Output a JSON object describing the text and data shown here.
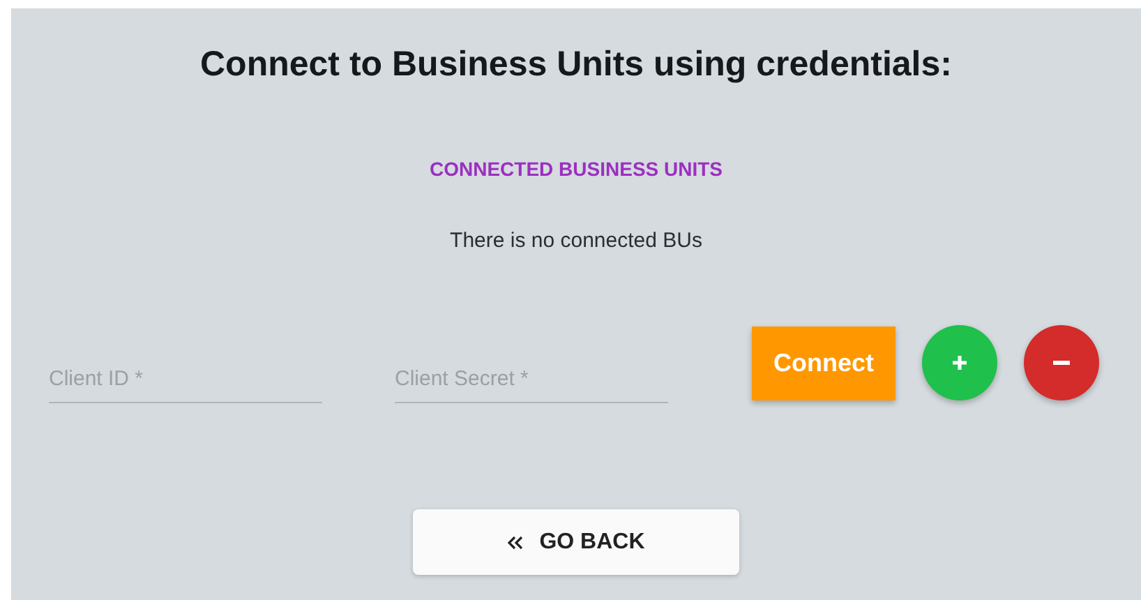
{
  "title": "Connect to Business Units using credentials:",
  "connected_section": {
    "heading": "CONNECTED BUSINESS UNITS",
    "empty_message": "There is no connected BUs"
  },
  "fields": [
    {
      "placeholder": "Client ID *"
    },
    {
      "placeholder": "Client Secret *"
    }
  ],
  "buttons": [
    {
      "kind": "text",
      "label": "Connect"
    },
    {
      "kind": "add"
    },
    {
      "kind": "remove"
    }
  ],
  "back_button": {
    "label": "GO BACK"
  }
}
